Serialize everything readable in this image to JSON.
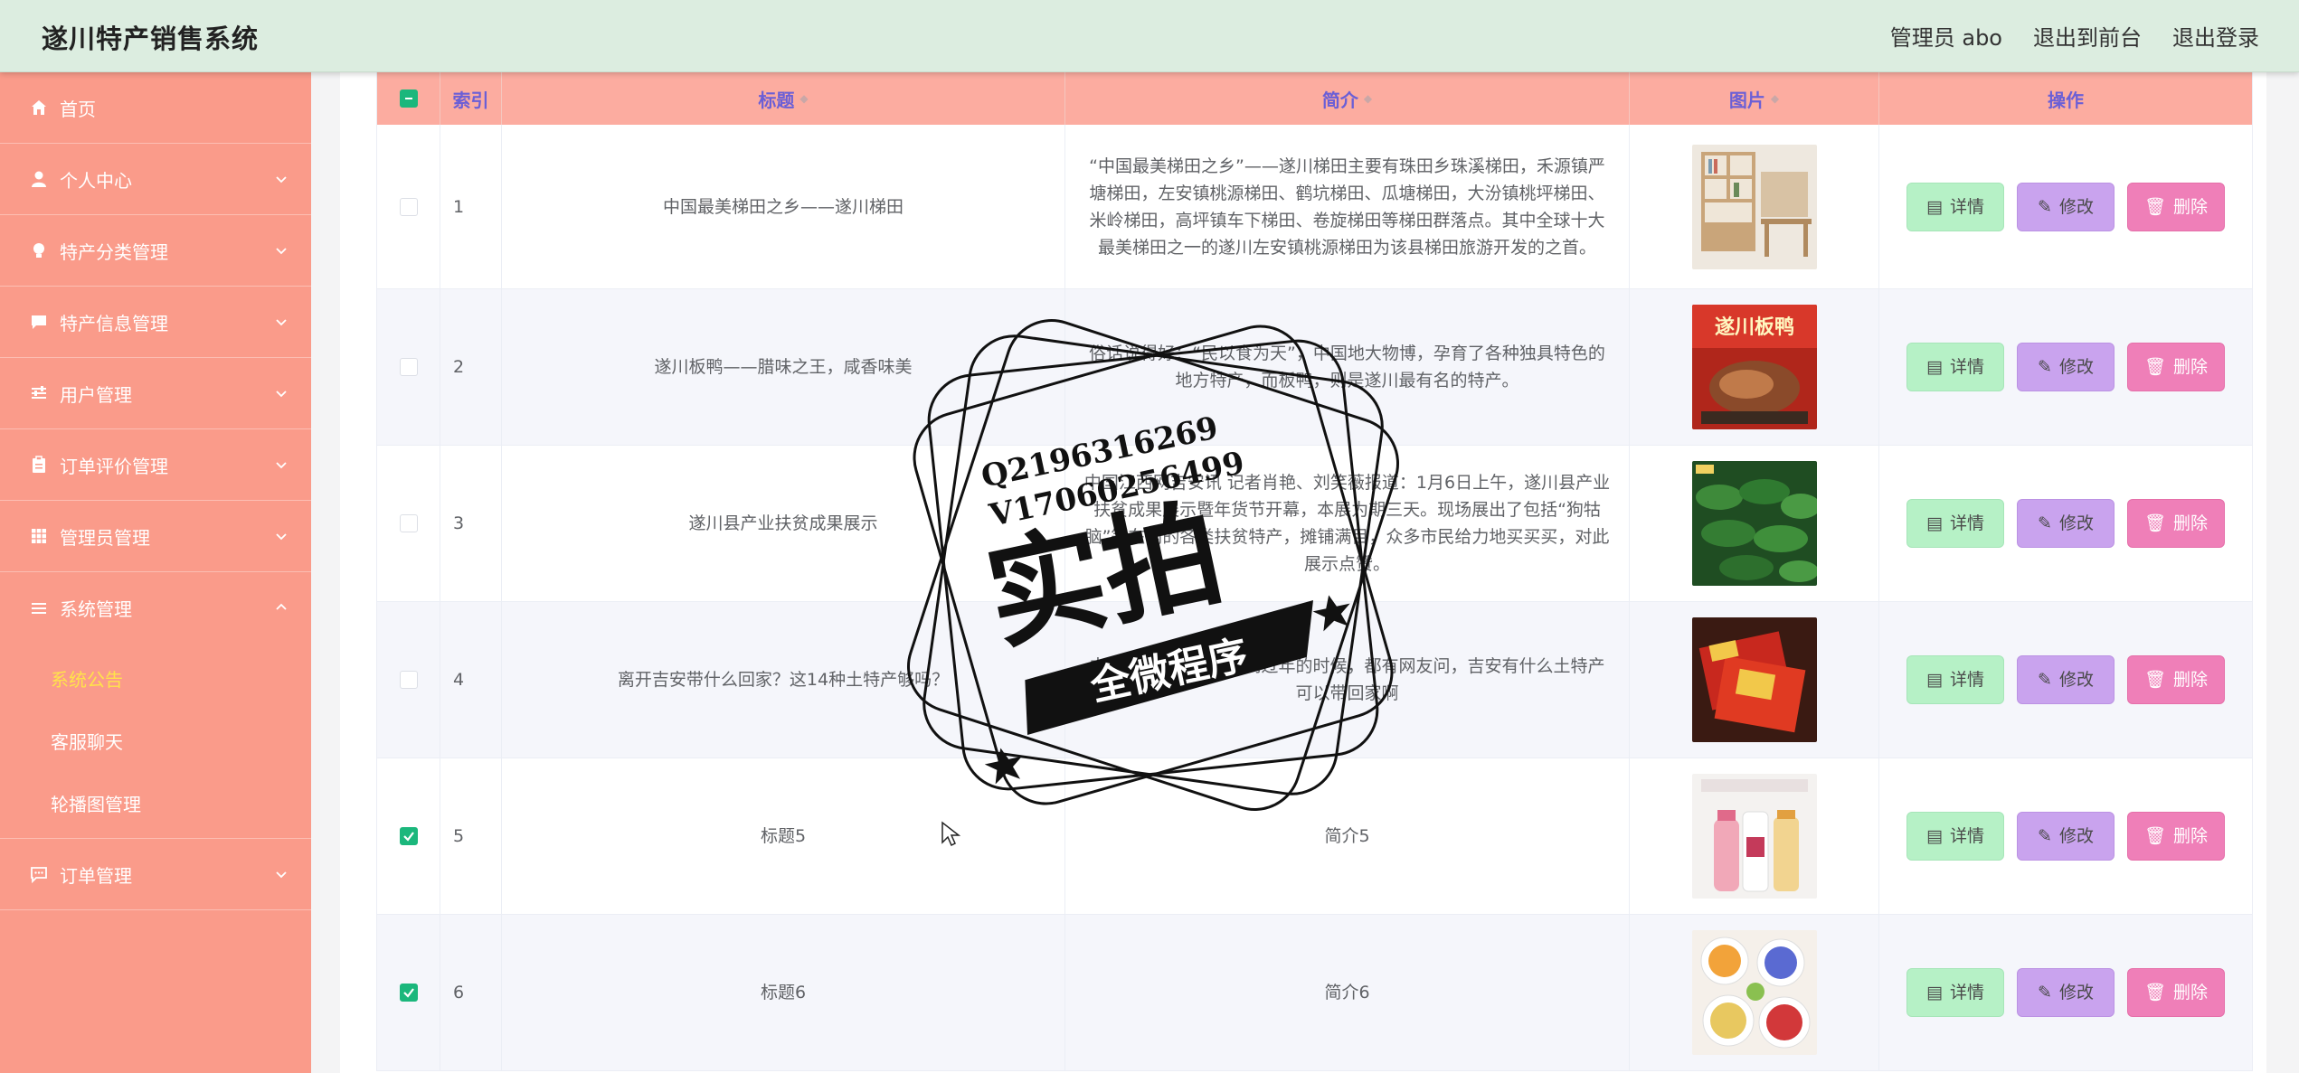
{
  "app": {
    "title": "遂川特产销售系统"
  },
  "header": {
    "user_label": "管理员 abo",
    "to_front_label": "退出到前台",
    "logout_label": "退出登录"
  },
  "sidebar": {
    "items": [
      {
        "label": "首页",
        "icon": "home-icon"
      },
      {
        "label": "个人中心",
        "icon": "user-icon"
      },
      {
        "label": "特产分类管理",
        "icon": "bulb-icon"
      },
      {
        "label": "特产信息管理",
        "icon": "message-icon"
      },
      {
        "label": "用户管理",
        "icon": "sliders-icon"
      },
      {
        "label": "订单评价管理",
        "icon": "clipboard-icon"
      },
      {
        "label": "管理员管理",
        "icon": "grid-icon"
      },
      {
        "label": "系统管理",
        "icon": "menu-icon"
      },
      {
        "label": "订单管理",
        "icon": "chat-icon"
      }
    ],
    "sub_items": [
      "系统公告",
      "客服聊天",
      "轮播图管理"
    ]
  },
  "table": {
    "columns": {
      "index": "索引",
      "title": "标题",
      "intro": "简介",
      "image": "图片",
      "ops": "操作"
    },
    "buttons": {
      "detail": "详情",
      "edit": "修改",
      "delete": "删除"
    },
    "rows": [
      {
        "index": "1",
        "title": "中国最美梯田之乡——遂川梯田",
        "intro": "“中国最美梯田之乡”——遂川梯田主要有珠田乡珠溪梯田，禾源镇严塘梯田，左安镇桃源梯田、鹤坑梯田、瓜塘梯田，大汾镇桃坪梯田、米岭梯田，高坪镇车下梯田、卷旋梯田等梯田群落点。其中全球十大最美梯田之一的遂川左安镇桃源梯田为该县梯田旅游开发的之首。",
        "checked": false,
        "image": "bookshelf"
      },
      {
        "index": "2",
        "title": "遂川板鸭——腊味之王，咸香味美",
        "intro": "俗话说得好：“民以食为天”，中国地大物博，孕育了各种独具特色的地方特产，而板鸭，则是遂川最有名的特产。",
        "checked": false,
        "image": "duck"
      },
      {
        "index": "3",
        "title": "遂川县产业扶贫成果展示",
        "intro": "中国江西网吉安讯 记者肖艳、刘笑薇报道：1月6日上午，遂川县产业扶贫成果展示暨年货节开幕，本展为期三天。现场展出了包括“狗牯脑”等在内的各类扶贫特产，摊铺满目，众多市民给力地买买买，对此展示点赞。",
        "checked": false,
        "image": "leaves"
      },
      {
        "index": "4",
        "title": "离开吉安带什么回家？这14种土特产够吗？",
        "intro": "中国人有个习俗，每到过年的时候，都有网友问，吉安有什么土特产可以带回家啊",
        "checked": false,
        "image": "giftbox"
      },
      {
        "index": "5",
        "title": "标题5",
        "intro": "简介5",
        "checked": true,
        "image": "drinks"
      },
      {
        "index": "6",
        "title": "标题6",
        "intro": "简介6",
        "checked": true,
        "image": "fruits"
      }
    ]
  },
  "watermark": {
    "line1": "Q2196316269",
    "line2": "V17060256499",
    "big": "实拍",
    "banner": "全微程序"
  }
}
